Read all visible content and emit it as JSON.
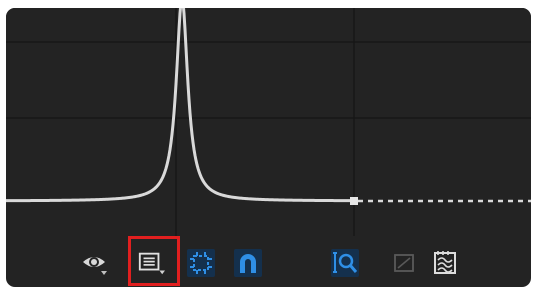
{
  "window": {
    "type": "graph-editor-panel"
  },
  "graph": {
    "colors": {
      "background": "#232323",
      "grid": "#161616",
      "curve": "#d9d9d9",
      "keyframe": "#e6e6e6"
    },
    "curve": {
      "type": "peak",
      "extrapolation": "dashed-constant"
    }
  },
  "toolbar": {
    "buttons": [
      {
        "id": "visibility",
        "icon": "eye-icon",
        "has_dropdown": true,
        "active": false
      },
      {
        "id": "channel-list",
        "icon": "list-view-icon",
        "has_dropdown": true,
        "active": false,
        "highlighted": true
      },
      {
        "id": "frame-all",
        "icon": "frame-selection-icon",
        "has_dropdown": false,
        "active": true
      },
      {
        "id": "snapping",
        "icon": "magnet-icon",
        "has_dropdown": false,
        "active": true
      },
      {
        "id": "zoom",
        "icon": "zoom-to-fit-icon",
        "has_dropdown": false,
        "active": true
      },
      {
        "id": "normalize",
        "icon": "normalize-icon",
        "has_dropdown": false,
        "active": false,
        "disabled": true
      },
      {
        "id": "bake",
        "icon": "curve-bake-icon",
        "has_dropdown": false,
        "active": false
      }
    ],
    "highlight_color": "#e11f1f",
    "active_color": "#2f8fe6"
  }
}
